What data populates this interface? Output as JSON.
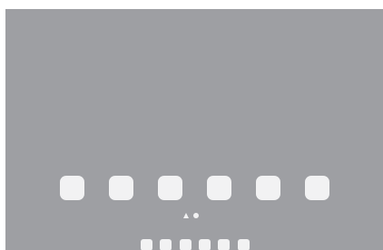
{
  "home_screen": {
    "background_color": "#9e9fa3",
    "icon_color": "#f2f2f3",
    "app_icons": [
      {
        "icon": "app-icon"
      },
      {
        "icon": "app-icon"
      },
      {
        "icon": "app-icon"
      },
      {
        "icon": "app-icon"
      },
      {
        "icon": "app-icon"
      },
      {
        "icon": "app-icon"
      }
    ],
    "page_indicator": {
      "pages": [
        "search-page",
        "page-1"
      ],
      "current_page_index": 1
    },
    "dock_icons": [
      {
        "icon": "dock-app-icon"
      },
      {
        "icon": "dock-app-icon"
      },
      {
        "icon": "dock-app-icon"
      },
      {
        "icon": "dock-app-icon"
      },
      {
        "icon": "dock-app-icon"
      },
      {
        "icon": "dock-app-icon"
      }
    ]
  }
}
